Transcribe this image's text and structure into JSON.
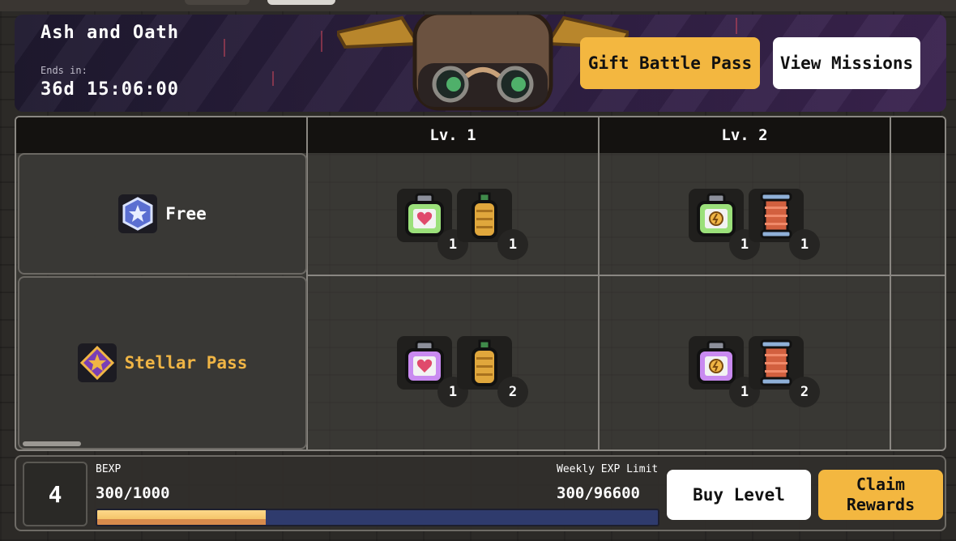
{
  "banner": {
    "title": "Ash and Oath",
    "ends_label": "Ends in:",
    "ends_time": "36d 15:06:00",
    "gift_button": "Gift Battle Pass",
    "missions_button": "View Missions"
  },
  "levels": [
    "Lv. 1",
    "Lv. 2"
  ],
  "tracks": {
    "free": {
      "label": "Free",
      "rewards": [
        [
          {
            "icon": "health-potion-icon",
            "qty": "1"
          },
          {
            "icon": "bottle-icon",
            "qty": "1"
          }
        ],
        [
          {
            "icon": "energy-potion-icon",
            "qty": "1"
          },
          {
            "icon": "scroll-icon",
            "qty": "1"
          }
        ]
      ]
    },
    "stellar": {
      "label": "Stellar Pass",
      "rewards": [
        [
          {
            "icon": "health-potion-icon",
            "qty": "1"
          },
          {
            "icon": "bottle-icon",
            "qty": "2"
          }
        ],
        [
          {
            "icon": "energy-potion-icon",
            "qty": "1"
          },
          {
            "icon": "scroll-icon",
            "qty": "2"
          }
        ]
      ]
    }
  },
  "bottom": {
    "level": "4",
    "bexp_label": "BEXP",
    "bexp_value": "300/1000",
    "bexp_progress": 0.3,
    "weekly_label": "Weekly EXP Limit",
    "weekly_value": "300/96600",
    "buy_level_button": "Buy Level",
    "claim_rewards_button": "Claim Rewards"
  },
  "colors": {
    "accent_gold": "#f3b740",
    "free_potion": "#9be07a",
    "stellar_potion": "#c98af0",
    "progress_track": "#2f3b6d"
  }
}
